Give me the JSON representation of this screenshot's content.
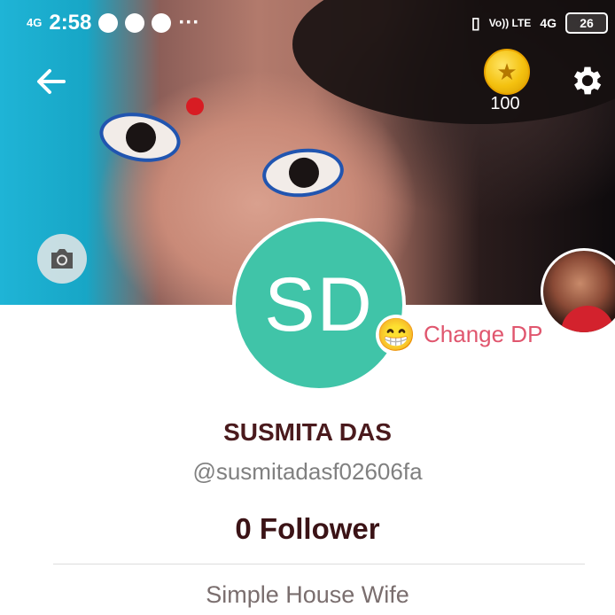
{
  "status_bar": {
    "network_left": "4G",
    "time": "2:58",
    "notification_icons": [
      "upload-icon",
      "youtube-icon",
      "message-icon"
    ],
    "more": "···",
    "volte": "Vo)) LTE",
    "network_right": "4G",
    "battery": "26"
  },
  "header": {
    "back_icon": "arrow-left-icon",
    "coin_icon": "star-coin-icon",
    "coins": "100",
    "settings_icon": "gear-icon"
  },
  "profile": {
    "initials": "SD",
    "avatar_color": "#40c4a8",
    "emoji": "😁",
    "change_dp_label": "Change DP",
    "name": "SUSMITA DAS",
    "handle": "@susmitadasf02606fa",
    "followers": "0 Follower",
    "bio": "Simple House Wife"
  },
  "colors": {
    "accent_pink": "#e0566e",
    "name_color": "#4a1a1d"
  }
}
